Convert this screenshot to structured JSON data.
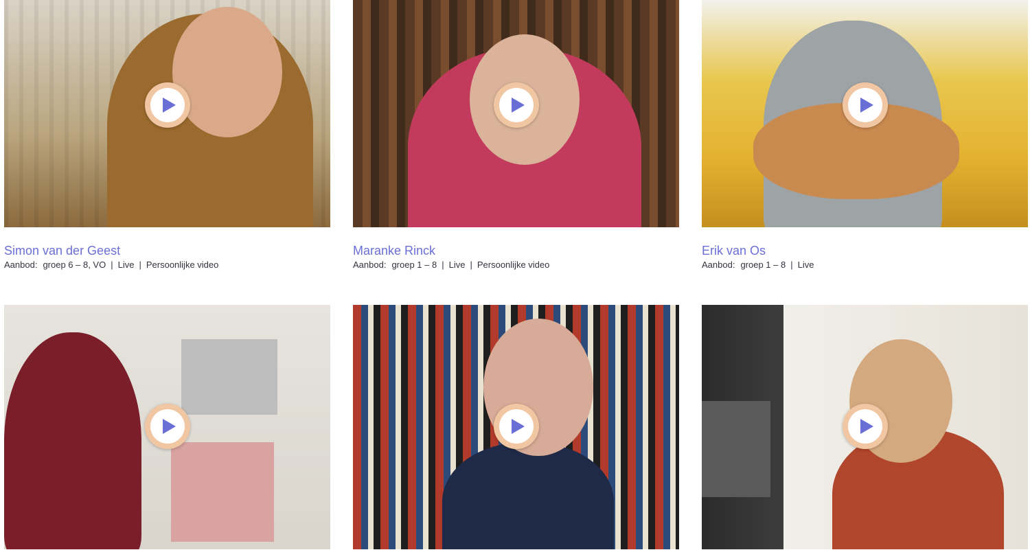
{
  "colors": {
    "name_link": "#6a6fd6",
    "meta_text": "#333340",
    "play_ring": "#f1c7a3",
    "play_triangle": "#6a6fd6"
  },
  "play_icon": "play-icon",
  "cards": [
    {
      "name": "Simon van der Geest",
      "meta_label": "Aanbod:",
      "meta_items": [
        "groep 6 – 8, VO",
        "Live",
        "Persoonlijke video"
      ]
    },
    {
      "name": "Maranke Rinck",
      "meta_label": "Aanbod:",
      "meta_items": [
        "groep 1 – 8",
        "Live",
        "Persoonlijke video"
      ]
    },
    {
      "name": "Erik van Os",
      "meta_label": "Aanbod:",
      "meta_items": [
        "groep 1 – 8",
        "Live"
      ]
    },
    {
      "name": "",
      "meta_label": "",
      "meta_items": []
    },
    {
      "name": "",
      "meta_label": "",
      "meta_items": []
    },
    {
      "name": "",
      "meta_label": "",
      "meta_items": []
    }
  ]
}
